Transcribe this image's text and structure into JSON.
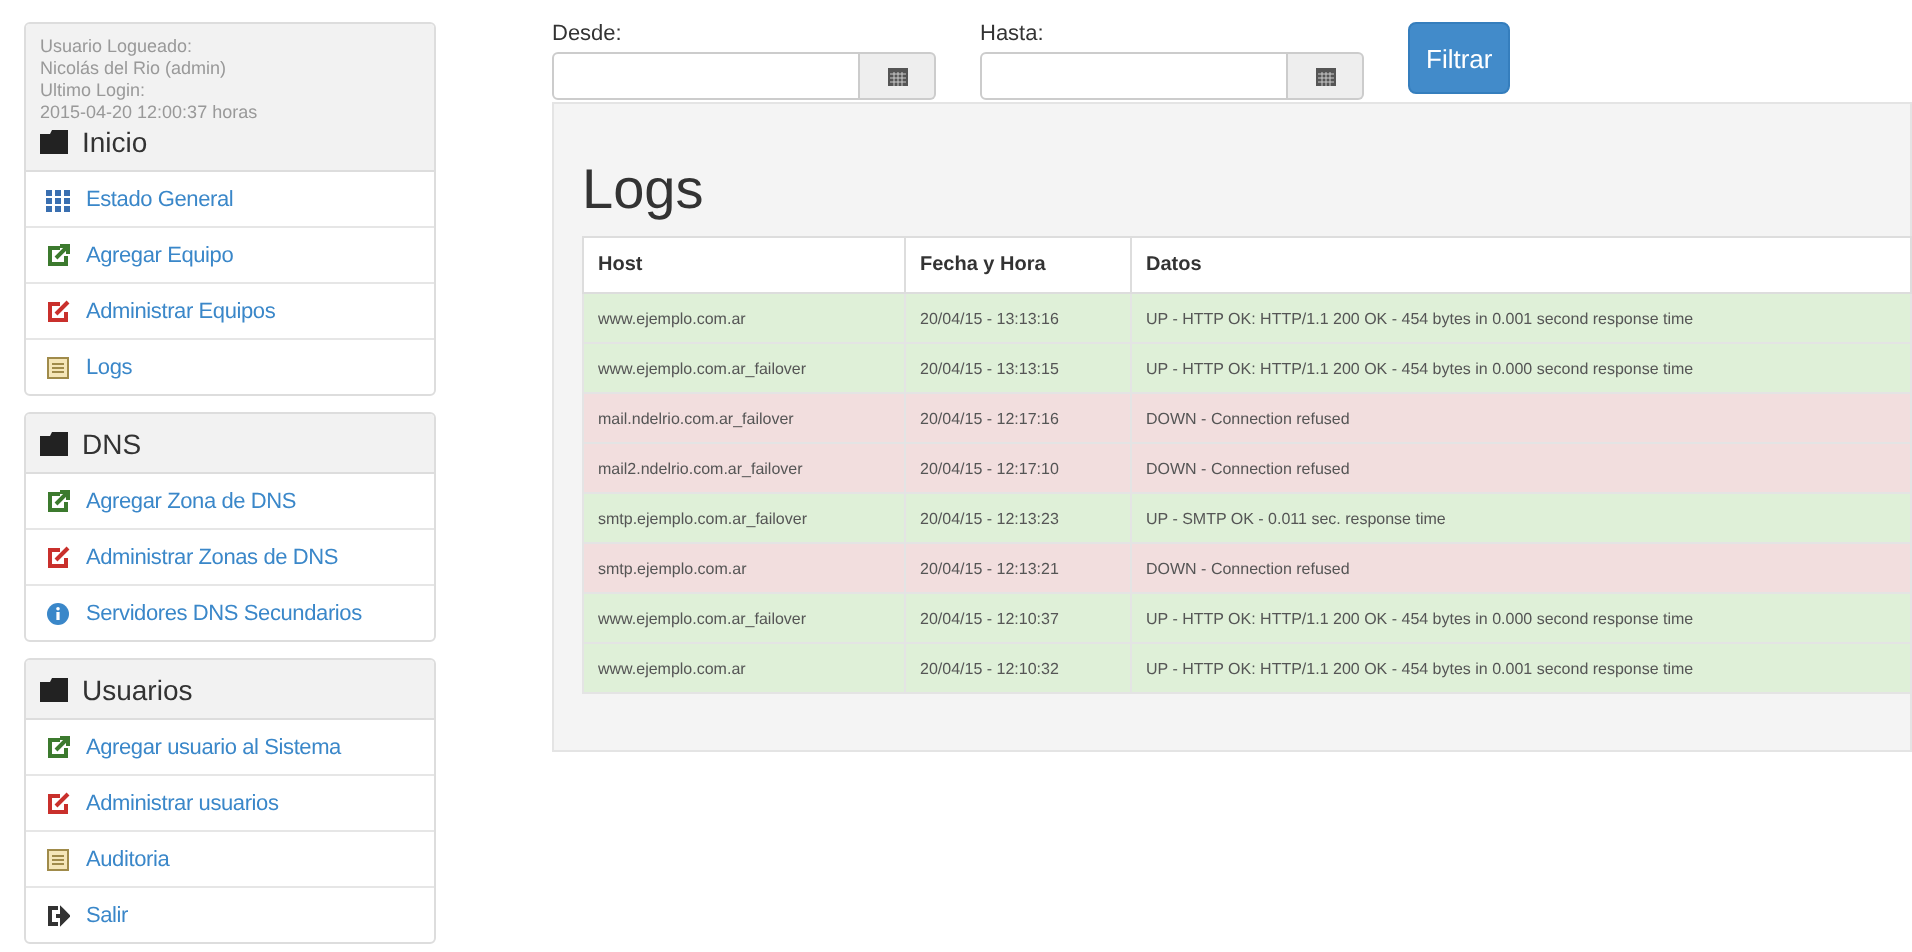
{
  "user_info": [
    "Usuario Logueado:",
    "Nicolás del Rio (admin)",
    "Ultimo Login:",
    "2015-04-20 12:00:37 horas"
  ],
  "sidebar": [
    {
      "title": "Inicio",
      "items": [
        {
          "label": "Estado General",
          "kind": "grid"
        },
        {
          "label": "Agregar Equipo",
          "kind": "add"
        },
        {
          "label": "Administrar Equipos",
          "kind": "edit"
        },
        {
          "label": "Logs",
          "kind": "list"
        }
      ]
    },
    {
      "title": "DNS",
      "items": [
        {
          "label": "Agregar Zona de DNS",
          "kind": "add"
        },
        {
          "label": "Administrar Zonas de DNS",
          "kind": "edit"
        },
        {
          "label": "Servidores DNS Secundarios",
          "kind": "info"
        }
      ]
    },
    {
      "title": "Usuarios",
      "items": [
        {
          "label": "Agregar usuario al Sistema",
          "kind": "add"
        },
        {
          "label": "Administrar usuarios",
          "kind": "edit"
        },
        {
          "label": "Auditoria",
          "kind": "list"
        },
        {
          "label": "Salir",
          "kind": "logout"
        }
      ]
    }
  ],
  "filters": [
    {
      "label": "Desde:"
    },
    {
      "label": "Hasta:"
    }
  ],
  "filter_button": "Filtrar",
  "heading": "Logs",
  "table": {
    "columns": [
      "Host",
      "Fecha y Hora",
      "Datos"
    ],
    "rows": [
      {
        "kind": "up",
        "cells": [
          "www.ejemplo.com.ar",
          "20/04/15 - 13:13:16",
          "UP - HTTP OK: HTTP/1.1 200 OK - 454 bytes in 0.001 second response time"
        ]
      },
      {
        "kind": "up",
        "cells": [
          "www.ejemplo.com.ar_failover",
          "20/04/15 - 13:13:15",
          "UP - HTTP OK: HTTP/1.1 200 OK - 454 bytes in 0.000 second response time"
        ]
      },
      {
        "kind": "down",
        "cells": [
          "mail.ndelrio.com.ar_failover",
          "20/04/15 - 12:17:16",
          "DOWN - Connection refused"
        ]
      },
      {
        "kind": "down",
        "cells": [
          "mail2.ndelrio.com.ar_failover",
          "20/04/15 - 12:17:10",
          "DOWN - Connection refused"
        ]
      },
      {
        "kind": "up",
        "cells": [
          "smtp.ejemplo.com.ar_failover",
          "20/04/15 - 12:13:23",
          "UP - SMTP OK - 0.011 sec. response time"
        ]
      },
      {
        "kind": "down",
        "cells": [
          "smtp.ejemplo.com.ar",
          "20/04/15 - 12:13:21",
          "DOWN - Connection refused"
        ]
      },
      {
        "kind": "up",
        "cells": [
          "www.ejemplo.com.ar_failover",
          "20/04/15 - 12:10:37",
          "UP - HTTP OK: HTTP/1.1 200 OK - 454 bytes in 0.000 second response time"
        ]
      },
      {
        "kind": "up",
        "cells": [
          "www.ejemplo.com.ar",
          "20/04/15 - 12:10:32",
          "UP - HTTP OK: HTTP/1.1 200 OK - 454 bytes in 0.001 second response time"
        ]
      }
    ]
  }
}
